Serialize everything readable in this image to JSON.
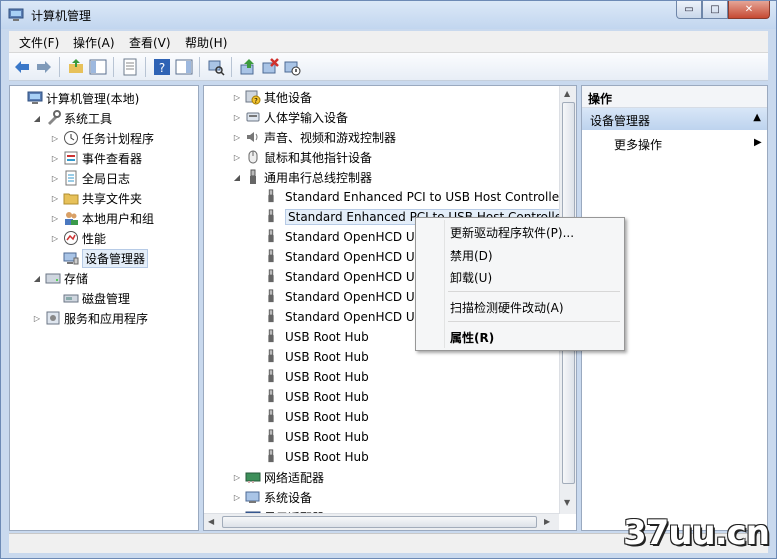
{
  "window": {
    "title": "计算机管理",
    "buttons": {
      "minimize": "▭",
      "maximize": "□",
      "close": "✕"
    }
  },
  "menu": [
    "文件(F)",
    "操作(A)",
    "查看(V)",
    "帮助(H)"
  ],
  "left_tree": [
    {
      "label": "计算机管理(本地)",
      "level": 0,
      "expander": "",
      "icon": "computer-icon"
    },
    {
      "label": "系统工具",
      "level": 1,
      "expander": "◢",
      "icon": "tools-icon"
    },
    {
      "label": "任务计划程序",
      "level": 2,
      "expander": "▷",
      "icon": "clock-icon"
    },
    {
      "label": "事件查看器",
      "level": 2,
      "expander": "▷",
      "icon": "event-viewer-icon"
    },
    {
      "label": "全局日志",
      "level": 2,
      "expander": "▷",
      "icon": "log-icon"
    },
    {
      "label": "共享文件夹",
      "level": 2,
      "expander": "▷",
      "icon": "folder-icon"
    },
    {
      "label": "本地用户和组",
      "level": 2,
      "expander": "▷",
      "icon": "users-icon"
    },
    {
      "label": "性能",
      "level": 2,
      "expander": "▷",
      "icon": "performance-icon"
    },
    {
      "label": "设备管理器",
      "level": 2,
      "expander": "",
      "icon": "device-manager-icon",
      "selected": true
    },
    {
      "label": "存储",
      "level": 1,
      "expander": "◢",
      "icon": "storage-icon"
    },
    {
      "label": "磁盘管理",
      "level": 2,
      "expander": "",
      "icon": "disk-icon"
    },
    {
      "label": "服务和应用程序",
      "level": 1,
      "expander": "▷",
      "icon": "services-icon"
    }
  ],
  "mid_tree": [
    {
      "label": "其他设备",
      "kind": "category",
      "expander": "▷",
      "icon": "unknown-device-icon"
    },
    {
      "label": "人体学输入设备",
      "kind": "category",
      "expander": "▷",
      "icon": "hid-icon"
    },
    {
      "label": "声音、视频和游戏控制器",
      "kind": "category",
      "expander": "▷",
      "icon": "speaker-icon"
    },
    {
      "label": "鼠标和其他指针设备",
      "kind": "category",
      "expander": "▷",
      "icon": "mouse-icon"
    },
    {
      "label": "通用串行总线控制器",
      "kind": "category",
      "expander": "◢",
      "icon": "usb-icon"
    },
    {
      "label": "Standard Enhanced PCI to USB Host Controller",
      "kind": "device"
    },
    {
      "label": "Standard Enhanced PCI to USB Host Controller",
      "kind": "device",
      "selected": true
    },
    {
      "label": "Standard OpenHCD USB Host Controller",
      "kind": "device"
    },
    {
      "label": "Standard OpenHCD USB Host Controller",
      "kind": "device"
    },
    {
      "label": "Standard OpenHCD USB Host Controller",
      "kind": "device"
    },
    {
      "label": "Standard OpenHCD USB Host Controller",
      "kind": "device"
    },
    {
      "label": "Standard OpenHCD USB Host Controller",
      "kind": "device"
    },
    {
      "label": "USB Root Hub",
      "kind": "device"
    },
    {
      "label": "USB Root Hub",
      "kind": "device"
    },
    {
      "label": "USB Root Hub",
      "kind": "device"
    },
    {
      "label": "USB Root Hub",
      "kind": "device"
    },
    {
      "label": "USB Root Hub",
      "kind": "device"
    },
    {
      "label": "USB Root Hub",
      "kind": "device"
    },
    {
      "label": "USB Root Hub",
      "kind": "device"
    },
    {
      "label": "网络适配器",
      "kind": "category",
      "expander": "▷",
      "icon": "network-adapter-icon"
    },
    {
      "label": "系统设备",
      "kind": "category",
      "expander": "▷",
      "icon": "system-devices-icon"
    },
    {
      "label": "显示适配器",
      "kind": "category",
      "expander": "▷",
      "icon": "display-adapter-icon"
    }
  ],
  "context_menu": {
    "items": [
      "更新驱动程序软件(P)...",
      "禁用(D)",
      "卸载(U)",
      "扫描检测硬件改动(A)",
      "属性(R)"
    ]
  },
  "actions": {
    "header": "操作",
    "selected": "设备管理器",
    "more": "更多操作",
    "selected_arrow": "▲",
    "more_arrow": "▶"
  },
  "watermark": "37uu.cn",
  "colors": {
    "selection": "#e4eef9",
    "accent": "#bdd3ee"
  }
}
